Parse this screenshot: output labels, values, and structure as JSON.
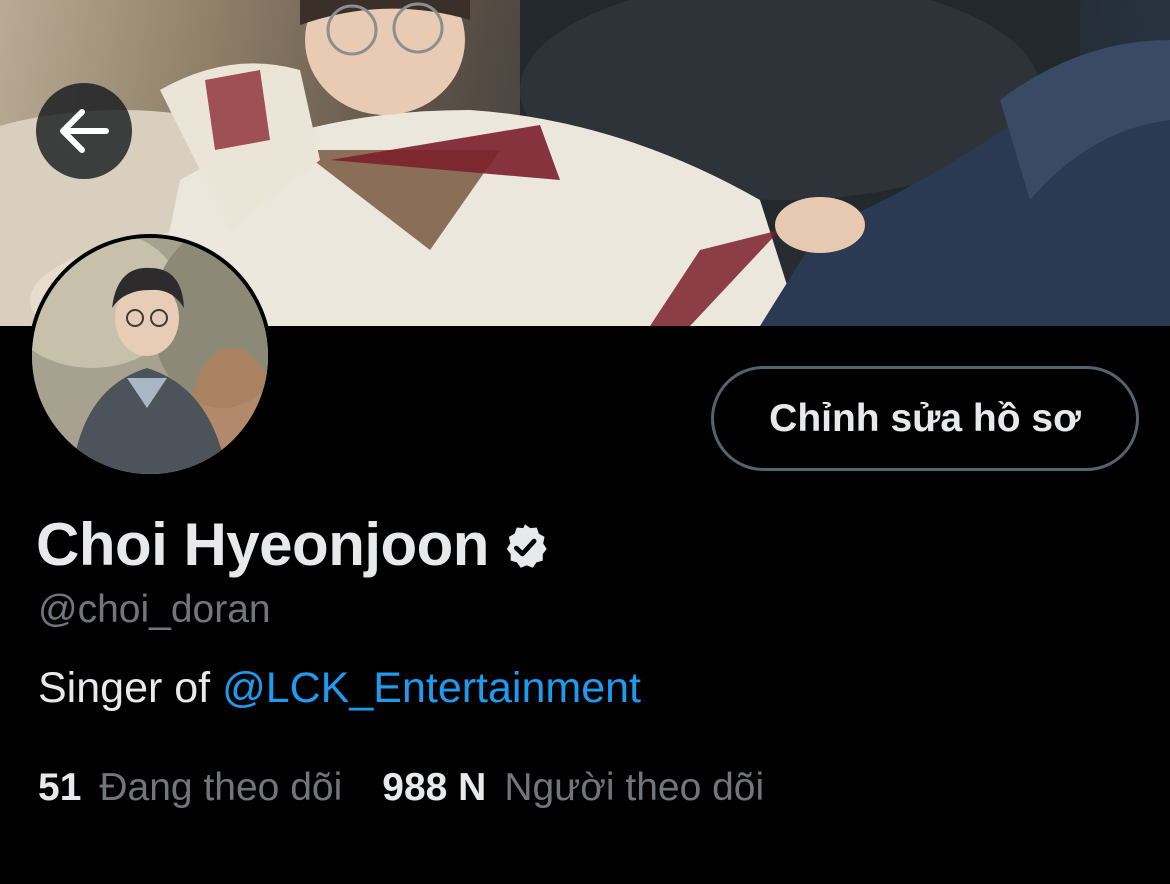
{
  "header": {
    "back_icon": "arrow-left-icon"
  },
  "profile": {
    "edit_button_label": "Chỉnh sửa hồ sơ",
    "display_name": "Choi Hyeonjoon",
    "verified_icon": "verified-badge-icon",
    "handle": "@choi_doran",
    "bio_text": "Singer of ",
    "bio_link": "@LCK_Entertainment"
  },
  "stats": {
    "following_count": "51",
    "following_label": "Đang theo dõi",
    "followers_count": "988 N",
    "followers_label": "Người theo dõi"
  },
  "colors": {
    "background": "#000000",
    "text": "#e7e9ea",
    "secondary": "#71767b",
    "link": "#1d9bf0",
    "border": "#536471"
  }
}
